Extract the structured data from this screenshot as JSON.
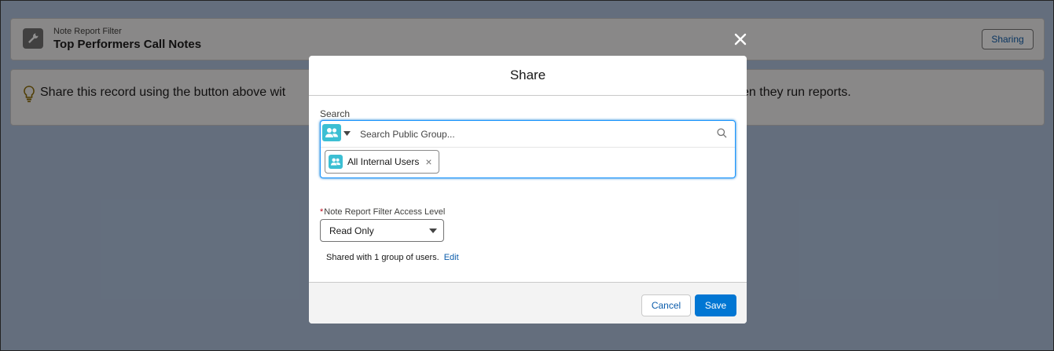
{
  "header": {
    "object_type": "Note Report Filter",
    "record_title": "Top Performers Call Notes",
    "sharing_label": "Sharing"
  },
  "info": {
    "text": "Share this record using the button above wit",
    "text_tail": "en they run reports."
  },
  "modal": {
    "title": "Share",
    "search": {
      "label": "Search",
      "placeholder": "Search Public Group...",
      "selected": [
        {
          "label": "All Internal Users"
        }
      ]
    },
    "access": {
      "label": "Note Report Filter Access Level",
      "required_mark": "*",
      "value": "Read Only"
    },
    "shared_text": "Shared with 1 group of users.",
    "edit_link": "Edit",
    "cancel_label": "Cancel",
    "save_label": "Save"
  },
  "icons": {
    "object": "wrench-icon",
    "tip": "lightbulb-icon",
    "close": "close-icon",
    "group": "groups-icon",
    "search": "search-icon"
  },
  "colors": {
    "brand": "#0176d3",
    "link": "#0b5cab",
    "group_icon": "#3cbfd3"
  }
}
